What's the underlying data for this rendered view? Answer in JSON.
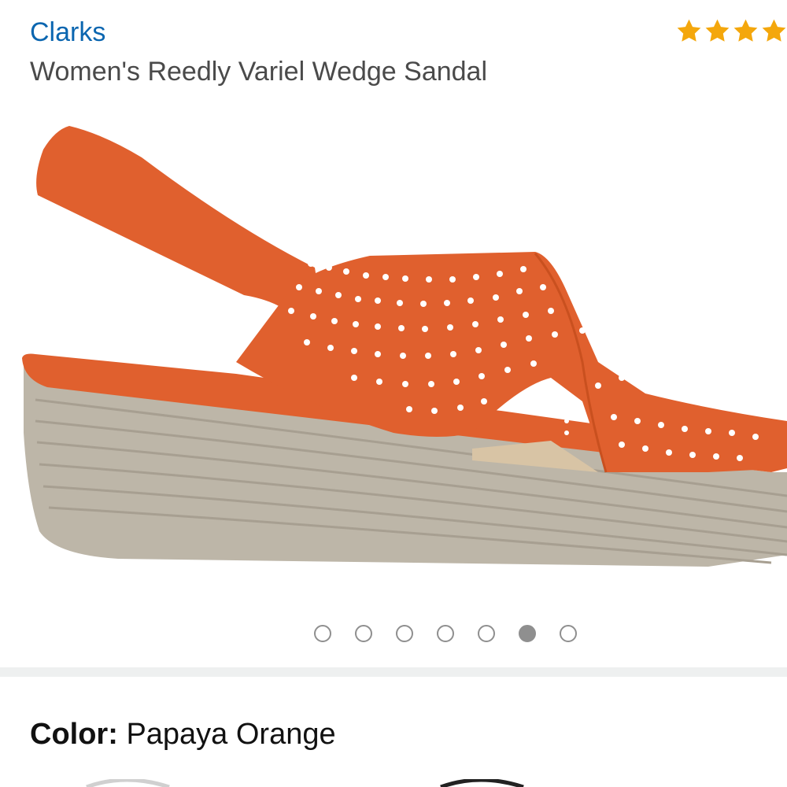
{
  "product": {
    "brand": "Clarks",
    "title": "Women's Reedly Variel Wedge Sandal",
    "rating": 4,
    "rating_max": 5
  },
  "carousel": {
    "total": 7,
    "active_index": 5
  },
  "color": {
    "label": "Color:",
    "value": "Papaya Orange"
  },
  "colors": {
    "brand_link": "#0b66b0",
    "star": "#f4a70c",
    "upper": "#e0602e",
    "sole": "#bdb6a8"
  },
  "icons": {
    "star": "star-icon",
    "dot": "carousel-dot"
  }
}
